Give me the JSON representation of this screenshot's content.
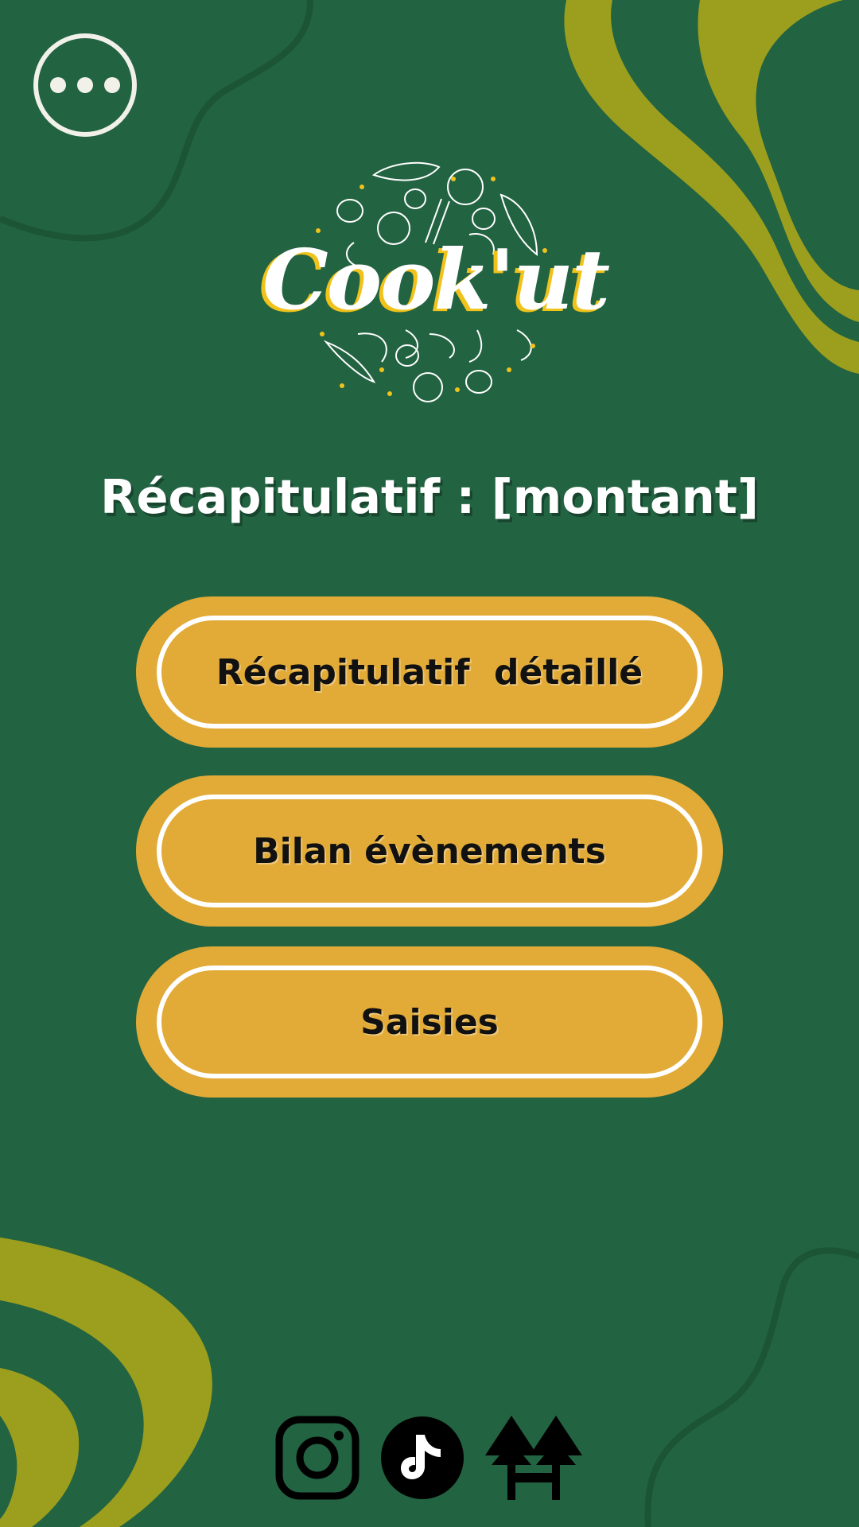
{
  "app": {
    "name": "Cook'ut"
  },
  "header": {
    "menu_icon": "more-horizontal-icon"
  },
  "logo": {
    "text": "Cook'ut"
  },
  "summary": {
    "title": "Récapitulatif : [montant]"
  },
  "actions": [
    {
      "label": "Récapitulatif  détaillé"
    },
    {
      "label": "Bilan évènements"
    },
    {
      "label": "Saisies"
    }
  ],
  "social": [
    {
      "icon": "instagram-icon"
    },
    {
      "icon": "tiktok-icon"
    },
    {
      "icon": "linktree-icon"
    }
  ],
  "colors": {
    "background": "#226341",
    "accent_olive": "#9c9f1e",
    "button": "#e2aa36",
    "logo_accent": "#f0c21a"
  }
}
